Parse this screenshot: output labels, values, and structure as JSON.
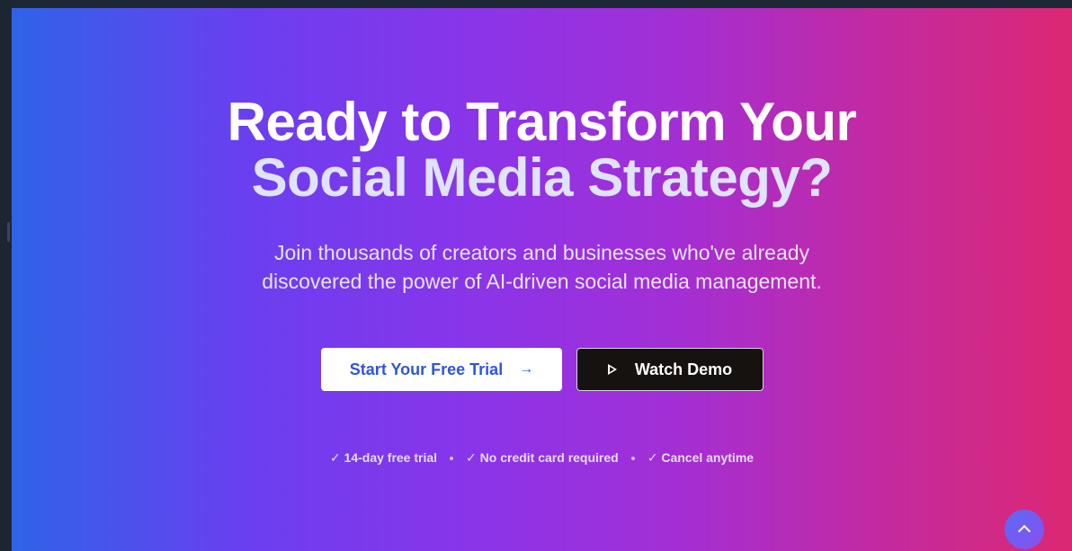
{
  "hero": {
    "headline_line1": "Ready to Transform Your",
    "headline_line2": "Social Media Strategy?",
    "subtext_line1": "Join thousands of creators and businesses who've already",
    "subtext_line2": "discovered the power of AI-driven social media management.",
    "primary_button_label": "Start Your Free Trial",
    "primary_button_icon": "arrow-right-icon",
    "secondary_button_label": "Watch Demo",
    "secondary_button_icon": "play-icon",
    "perks": [
      "✓ 14-day free trial",
      "✓ No credit card required",
      "✓ Cancel anytime"
    ]
  },
  "scroll_top": {
    "icon": "chevron-up-icon"
  },
  "colors": {
    "gradient_start": "#2f63e8",
    "gradient_mid": "#8c34e8",
    "gradient_end": "#dc2873",
    "primary_button_text": "#2f56d8",
    "secondary_button_bg": "#16120f"
  }
}
